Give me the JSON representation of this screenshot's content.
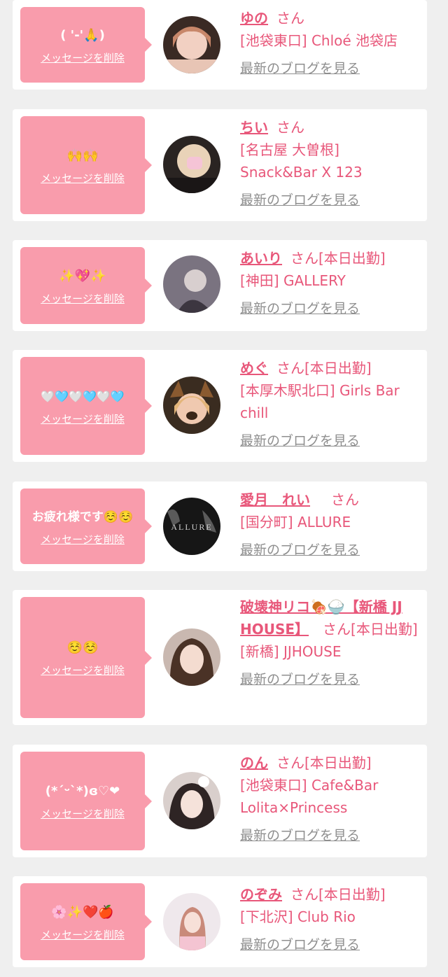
{
  "entries": [
    {
      "message": "( '-'🙏)",
      "delete_label": "メッセージを削除",
      "name": "ゆの",
      "suffix": "さん",
      "shop": "[池袋東口] Chloé 池袋店",
      "blog_label": "最新のブログを見る"
    },
    {
      "message": "🙌🙌",
      "delete_label": "メッセージを削除",
      "name": "ちい",
      "suffix": "さん",
      "shop": "[名古屋 大曽根] Snack&Bar X 123",
      "blog_label": "最新のブログを見る"
    },
    {
      "message": "✨💖✨",
      "delete_label": "メッセージを削除",
      "name": "あいり",
      "suffix": "さん[本日出勤]",
      "shop": "[神田] GALLERY",
      "blog_label": "最新のブログを見る"
    },
    {
      "message": "🤍🩵🤍🩵🤍🩵",
      "delete_label": "メッセージを削除",
      "name": "めぐ",
      "suffix": "さん[本日出勤]",
      "shop": "[本厚木駅北口] Girls Bar chill",
      "blog_label": "最新のブログを見る"
    },
    {
      "message": "お疲れ様です☺️☺️",
      "delete_label": "メッセージを削除",
      "name": "愛月　れい",
      "suffix": "さん",
      "shop": "[国分町] ALLURE",
      "blog_label": "最新のブログを見る"
    },
    {
      "message": "☺️☺️",
      "delete_label": "メッセージを削除",
      "name": "破壊神リコ🍖🍚【新橋 JJ HOUSE】",
      "suffix": "さん[本日出勤]",
      "shop": "[新橋] JJHOUSE",
      "blog_label": "最新のブログを見る"
    },
    {
      "message": "(*´ᵕ`*)ɞ♡❤",
      "delete_label": "メッセージを削除",
      "name": "のん",
      "suffix": "さん[本日出勤]",
      "shop": "[池袋東口] Cafe&Bar Lolita×Princess",
      "blog_label": "最新のブログを見る"
    },
    {
      "message": "🌸✨❤️🍎",
      "delete_label": "メッセージを削除",
      "name": "のぞみ",
      "suffix": "さん[本日出勤]",
      "shop": "[下北沢] Club Rio",
      "blog_label": "最新のブログを見る"
    }
  ],
  "avatar_logo_text": "ALLURE",
  "colors": {
    "accent": "#e8577a",
    "bubble": "#f99cac",
    "muted": "#8f8f8f",
    "bg": "#efefef"
  }
}
